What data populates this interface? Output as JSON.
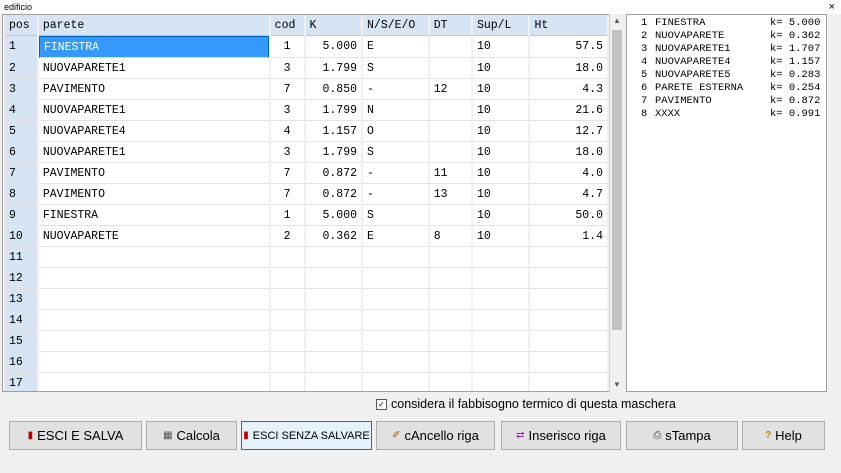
{
  "window": {
    "title": "edificio",
    "close_glyph": "×"
  },
  "grid": {
    "columns": [
      "pos",
      "parete",
      "cod",
      "K",
      "N/S/E/O",
      "DT",
      "Sup/L",
      "Ht"
    ],
    "rows": [
      [
        "1",
        "FINESTRA",
        "1",
        "5.000",
        "E",
        "",
        "10",
        "57.5"
      ],
      [
        "2",
        "NUOVAPARETE1",
        "3",
        "1.799",
        "S",
        "",
        "10",
        "18.0"
      ],
      [
        "3",
        "PAVIMENTO",
        "7",
        "0.850",
        "-",
        "12",
        "10",
        "4.3"
      ],
      [
        "4",
        "NUOVAPARETE1",
        "3",
        "1.799",
        "N",
        "",
        "10",
        "21.6"
      ],
      [
        "5",
        "NUOVAPARETE4",
        "4",
        "1.157",
        "O",
        "",
        "10",
        "12.7"
      ],
      [
        "6",
        "NUOVAPARETE1",
        "3",
        "1.799",
        "S",
        "",
        "10",
        "18.0"
      ],
      [
        "7",
        "PAVIMENTO",
        "7",
        "0.872",
        "-",
        "11",
        "10",
        "4.0"
      ],
      [
        "8",
        "PAVIMENTO",
        "7",
        "0.872",
        "-",
        "13",
        "10",
        "4.7"
      ],
      [
        "9",
        "FINESTRA",
        "1",
        "5.000",
        "S",
        "",
        "10",
        "50.0"
      ],
      [
        "10",
        "NUOVAPARETE",
        "2",
        "0.362",
        "E",
        "8",
        "10",
        "1.4"
      ],
      [
        "11",
        "",
        "",
        "",
        "",
        "",
        "",
        ""
      ],
      [
        "12",
        "",
        "",
        "",
        "",
        "",
        "",
        ""
      ],
      [
        "13",
        "",
        "",
        "",
        "",
        "",
        "",
        ""
      ],
      [
        "14",
        "",
        "",
        "",
        "",
        "",
        "",
        ""
      ],
      [
        "15",
        "",
        "",
        "",
        "",
        "",
        "",
        ""
      ],
      [
        "16",
        "",
        "",
        "",
        "",
        "",
        "",
        ""
      ],
      [
        "17",
        "",
        "",
        "",
        "",
        "",
        "",
        ""
      ]
    ]
  },
  "side_list": [
    {
      "n": "1",
      "name": "FINESTRA",
      "k": "k= 5.000"
    },
    {
      "n": "2",
      "name": "NUOVAPARETE",
      "k": "k= 0.362"
    },
    {
      "n": "3",
      "name": "NUOVAPARETE1",
      "k": "k= 1.707"
    },
    {
      "n": "4",
      "name": "NUOVAPARETE4",
      "k": "k= 1.157"
    },
    {
      "n": "5",
      "name": "NUOVAPARETE5",
      "k": "k= 0.283"
    },
    {
      "n": "6",
      "name": "PARETE ESTERNA",
      "k": "k= 0.254"
    },
    {
      "n": "7",
      "name": "PAVIMENTO",
      "k": "k= 0.872"
    },
    {
      "n": "8",
      "name": "XXXX",
      "k": "k= 0.991"
    }
  ],
  "checkbox": {
    "label": "considera il fabbisogno termico di questa maschera",
    "checked": true,
    "glyph": "☑"
  },
  "buttons": [
    {
      "icon": "exit-icon",
      "glyph": "▮",
      "label": "ESCI E SALVA"
    },
    {
      "icon": "calculator-icon",
      "glyph": "▦",
      "label": "Calcola"
    },
    {
      "icon": "exit-nosave-icon",
      "glyph": "▮",
      "label": "ESCI SENZA SALVARE"
    },
    {
      "icon": "eraser-icon",
      "glyph": "✐",
      "label": "cAncello riga"
    },
    {
      "icon": "insert-row-icon",
      "glyph": "⇄",
      "label": "Inserisco riga"
    },
    {
      "icon": "printer-icon",
      "glyph": "⎙",
      "label": "sTampa"
    },
    {
      "icon": "help-icon",
      "glyph": "?",
      "label": "Help"
    }
  ],
  "colors": {
    "header_bg": "#d6e4f3",
    "selection": "#3399ff",
    "accent": "#0078d7"
  }
}
